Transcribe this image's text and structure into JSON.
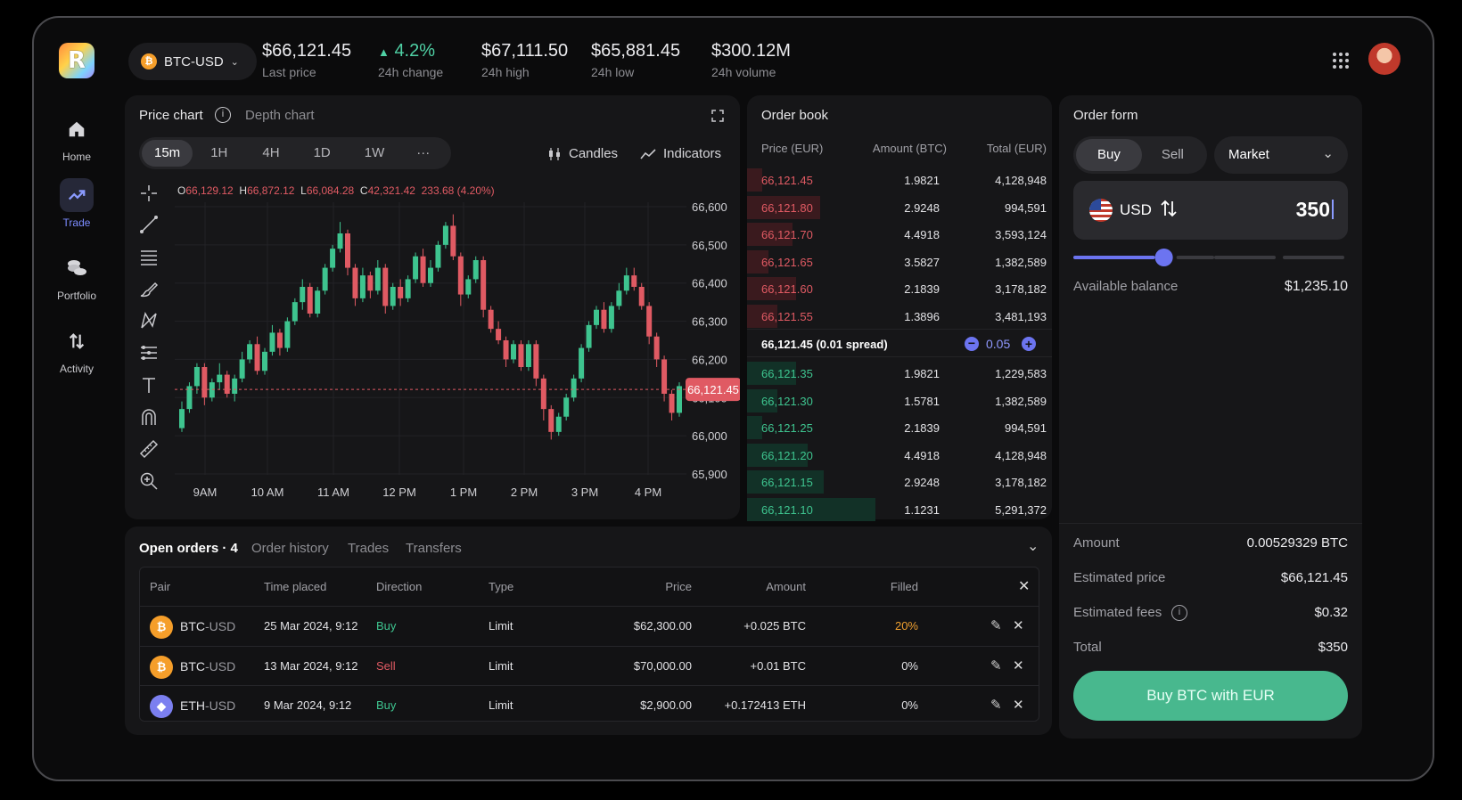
{
  "app": {
    "logo_letter": "R"
  },
  "nav": [
    {
      "label": "Home",
      "icon": "home-icon"
    },
    {
      "label": "Trade",
      "icon": "trend-icon",
      "active": true
    },
    {
      "label": "Portfolio",
      "icon": "coins-icon"
    },
    {
      "label": "Activity",
      "icon": "arrows-icon"
    }
  ],
  "header": {
    "pair": "BTC-USD",
    "stats": [
      {
        "value": "$66,121.45",
        "label": "Last price"
      },
      {
        "value": "4.2%",
        "label": "24h change"
      },
      {
        "value": "$67,111.50",
        "label": "24h high"
      },
      {
        "value": "$65,881.45",
        "label": "24h low"
      },
      {
        "value": "$300.12M",
        "label": "24h volume"
      }
    ]
  },
  "chart_panel": {
    "tab_price": "Price chart",
    "tab_depth": "Depth chart",
    "timeframes": [
      "15m",
      "1H",
      "4H",
      "1D",
      "1W",
      "···"
    ],
    "active_timeframe": "15m",
    "candles_label": "Candles",
    "indicators_label": "Indicators",
    "ohlc": {
      "o_label": "O",
      "o": "66,129.12",
      "h_label": "H",
      "h": "66,872.12",
      "l_label": "L",
      "l": "66,084.28",
      "c_label": "C",
      "c": "42,321.42",
      "chg": "233.68 (4.20%)"
    },
    "current_price_tag": "66,121.45"
  },
  "chart_data": {
    "type": "candlestick",
    "y_ticks": [
      "66,600",
      "66,500",
      "66,400",
      "66,300",
      "66,200",
      "66,100",
      "66,000",
      "65,900"
    ],
    "x_ticks": [
      "9AM",
      "10 AM",
      "11 AM",
      "12 PM",
      "1 PM",
      "2 PM",
      "3 PM",
      "4 PM"
    ],
    "ylim": [
      65900,
      66600
    ],
    "last_price": 66121.45,
    "candles": [
      [
        66020,
        66070,
        66010,
        66090,
        "up"
      ],
      [
        66070,
        66130,
        66060,
        66140,
        "up"
      ],
      [
        66130,
        66180,
        66110,
        66190,
        "up"
      ],
      [
        66180,
        66100,
        66080,
        66190,
        "down"
      ],
      [
        66100,
        66140,
        66090,
        66150,
        "up"
      ],
      [
        66140,
        66160,
        66120,
        66190,
        "up"
      ],
      [
        66160,
        66110,
        66100,
        66170,
        "down"
      ],
      [
        66110,
        66150,
        66090,
        66160,
        "up"
      ],
      [
        66150,
        66200,
        66140,
        66220,
        "up"
      ],
      [
        66200,
        66240,
        66190,
        66250,
        "up"
      ],
      [
        66240,
        66170,
        66160,
        66260,
        "down"
      ],
      [
        66170,
        66220,
        66160,
        66230,
        "up"
      ],
      [
        66220,
        66270,
        66210,
        66290,
        "up"
      ],
      [
        66270,
        66230,
        66210,
        66280,
        "down"
      ],
      [
        66230,
        66300,
        66220,
        66310,
        "up"
      ],
      [
        66300,
        66350,
        66290,
        66360,
        "up"
      ],
      [
        66350,
        66390,
        66330,
        66410,
        "up"
      ],
      [
        66390,
        66320,
        66310,
        66400,
        "down"
      ],
      [
        66320,
        66380,
        66310,
        66390,
        "up"
      ],
      [
        66380,
        66440,
        66370,
        66450,
        "up"
      ],
      [
        66440,
        66490,
        66430,
        66500,
        "up"
      ],
      [
        66490,
        66530,
        66480,
        66560,
        "up"
      ],
      [
        66530,
        66440,
        66420,
        66540,
        "down"
      ],
      [
        66440,
        66360,
        66340,
        66450,
        "down"
      ],
      [
        66360,
        66420,
        66350,
        66440,
        "up"
      ],
      [
        66420,
        66380,
        66360,
        66430,
        "down"
      ],
      [
        66380,
        66440,
        66370,
        66460,
        "up"
      ],
      [
        66440,
        66340,
        66320,
        66450,
        "down"
      ],
      [
        66340,
        66390,
        66330,
        66400,
        "up"
      ],
      [
        66390,
        66360,
        66340,
        66410,
        "down"
      ],
      [
        66360,
        66410,
        66350,
        66420,
        "up"
      ],
      [
        66410,
        66470,
        66400,
        66480,
        "up"
      ],
      [
        66470,
        66400,
        66390,
        66490,
        "down"
      ],
      [
        66400,
        66440,
        66390,
        66460,
        "up"
      ],
      [
        66440,
        66500,
        66430,
        66510,
        "up"
      ],
      [
        66500,
        66550,
        66490,
        66560,
        "up"
      ],
      [
        66550,
        66470,
        66460,
        66580,
        "down"
      ],
      [
        66470,
        66370,
        66340,
        66480,
        "down"
      ],
      [
        66370,
        66410,
        66360,
        66420,
        "up"
      ],
      [
        66410,
        66460,
        66400,
        66470,
        "up"
      ],
      [
        66460,
        66330,
        66310,
        66470,
        "down"
      ],
      [
        66330,
        66280,
        66270,
        66340,
        "down"
      ],
      [
        66280,
        66250,
        66240,
        66300,
        "down"
      ],
      [
        66250,
        66200,
        66180,
        66260,
        "down"
      ],
      [
        66200,
        66240,
        66190,
        66250,
        "up"
      ],
      [
        66240,
        66180,
        66170,
        66250,
        "down"
      ],
      [
        66180,
        66240,
        66170,
        66250,
        "up"
      ],
      [
        66240,
        66150,
        66130,
        66250,
        "down"
      ],
      [
        66150,
        66070,
        66040,
        66160,
        "down"
      ],
      [
        66070,
        66010,
        65990,
        66080,
        "down"
      ],
      [
        66010,
        66050,
        66000,
        66060,
        "up"
      ],
      [
        66050,
        66100,
        66040,
        66110,
        "up"
      ],
      [
        66100,
        66150,
        66090,
        66160,
        "up"
      ],
      [
        66150,
        66230,
        66140,
        66240,
        "up"
      ],
      [
        66230,
        66290,
        66220,
        66300,
        "up"
      ],
      [
        66290,
        66330,
        66280,
        66340,
        "up"
      ],
      [
        66330,
        66280,
        66270,
        66350,
        "down"
      ],
      [
        66280,
        66340,
        66270,
        66350,
        "up"
      ],
      [
        66340,
        66380,
        66330,
        66400,
        "up"
      ],
      [
        66380,
        66420,
        66370,
        66440,
        "up"
      ],
      [
        66420,
        66390,
        66380,
        66440,
        "down"
      ],
      [
        66390,
        66340,
        66330,
        66400,
        "down"
      ],
      [
        66340,
        66260,
        66240,
        66350,
        "down"
      ],
      [
        66260,
        66200,
        66180,
        66270,
        "down"
      ],
      [
        66200,
        66110,
        66090,
        66210,
        "down"
      ],
      [
        66110,
        66060,
        66040,
        66120,
        "down"
      ],
      [
        66060,
        66130,
        66050,
        66140,
        "up"
      ]
    ]
  },
  "order_book": {
    "title": "Order book",
    "headers": [
      "Price (EUR)",
      "Amount (BTC)",
      "Total (EUR)"
    ],
    "asks": [
      {
        "price": "66,121.45",
        "amount": "1.9821",
        "total": "4,128,948",
        "depth": 0.05
      },
      {
        "price": "66,121.80",
        "amount": "2.9248",
        "total": "994,591",
        "depth": 0.24
      },
      {
        "price": "66,121.70",
        "amount": "4.4918",
        "total": "3,593,124",
        "depth": 0.15
      },
      {
        "price": "66,121.65",
        "amount": "3.5827",
        "total": "1,382,589",
        "depth": 0.07
      },
      {
        "price": "66,121.60",
        "amount": "2.1839",
        "total": "3,178,182",
        "depth": 0.16
      },
      {
        "price": "66,121.55",
        "amount": "1.3896",
        "total": "3,481,193",
        "depth": 0.1
      }
    ],
    "spread_text": "66,121.45 (0.01 spread)",
    "spread_step": "0.05",
    "bids": [
      {
        "price": "66,121.35",
        "amount": "1.9821",
        "total": "1,229,583",
        "depth": 0.16
      },
      {
        "price": "66,121.30",
        "amount": "1.5781",
        "total": "1,382,589",
        "depth": 0.1
      },
      {
        "price": "66,121.25",
        "amount": "2.1839",
        "total": "994,591",
        "depth": 0.05
      },
      {
        "price": "66,121.20",
        "amount": "4.4918",
        "total": "4,128,948",
        "depth": 0.2
      },
      {
        "price": "66,121.15",
        "amount": "2.9248",
        "total": "3,178,182",
        "depth": 0.25
      },
      {
        "price": "66,121.10",
        "amount": "1.1231",
        "total": "5,291,372",
        "depth": 0.42
      }
    ]
  },
  "order_form": {
    "title": "Order form",
    "buy_label": "Buy",
    "sell_label": "Sell",
    "order_type": "Market",
    "currency": "USD",
    "amount_value": "350",
    "slider_value": 0.33,
    "available_label": "Available balance",
    "available_value": "$1,235.10",
    "summary": [
      {
        "label": "Amount",
        "value": "0.00529329 BTC"
      },
      {
        "label": "Estimated price",
        "value": "$66,121.45"
      },
      {
        "label": "Estimated fees",
        "value": "$0.32"
      },
      {
        "label": "Total",
        "value": "$350"
      }
    ],
    "submit_label": "Buy BTC with EUR"
  },
  "orders": {
    "tabs": [
      "Open orders · 4",
      "Order history",
      "Trades",
      "Transfers"
    ],
    "headers": [
      "Pair",
      "Time placed",
      "Direction",
      "Type",
      "Price",
      "Amount",
      "Filled"
    ],
    "rows": [
      {
        "base": "BTC",
        "quote": "-USD",
        "time": "25 Mar 2024, 9:12",
        "direction": "Buy",
        "type": "Limit",
        "price": "$62,300.00",
        "amount": "+0.025 BTC",
        "filled": "20%",
        "coin_color": "#f59e2a",
        "coin_glyph": "₿"
      },
      {
        "base": "BTC",
        "quote": "-USD",
        "time": "13 Mar 2024, 9:12",
        "direction": "Sell",
        "type": "Limit",
        "price": "$70,000.00",
        "amount": "+0.01 BTC",
        "filled": "0%",
        "coin_color": "#f59e2a",
        "coin_glyph": "₿"
      },
      {
        "base": "ETH",
        "quote": "-USD",
        "time": "9 Mar 2024, 9:12",
        "direction": "Buy",
        "type": "Limit",
        "price": "$2,900.00",
        "amount": "+0.172413 ETH",
        "filled": "0%",
        "coin_color": "#7b7ff0",
        "coin_glyph": "◆"
      }
    ]
  }
}
